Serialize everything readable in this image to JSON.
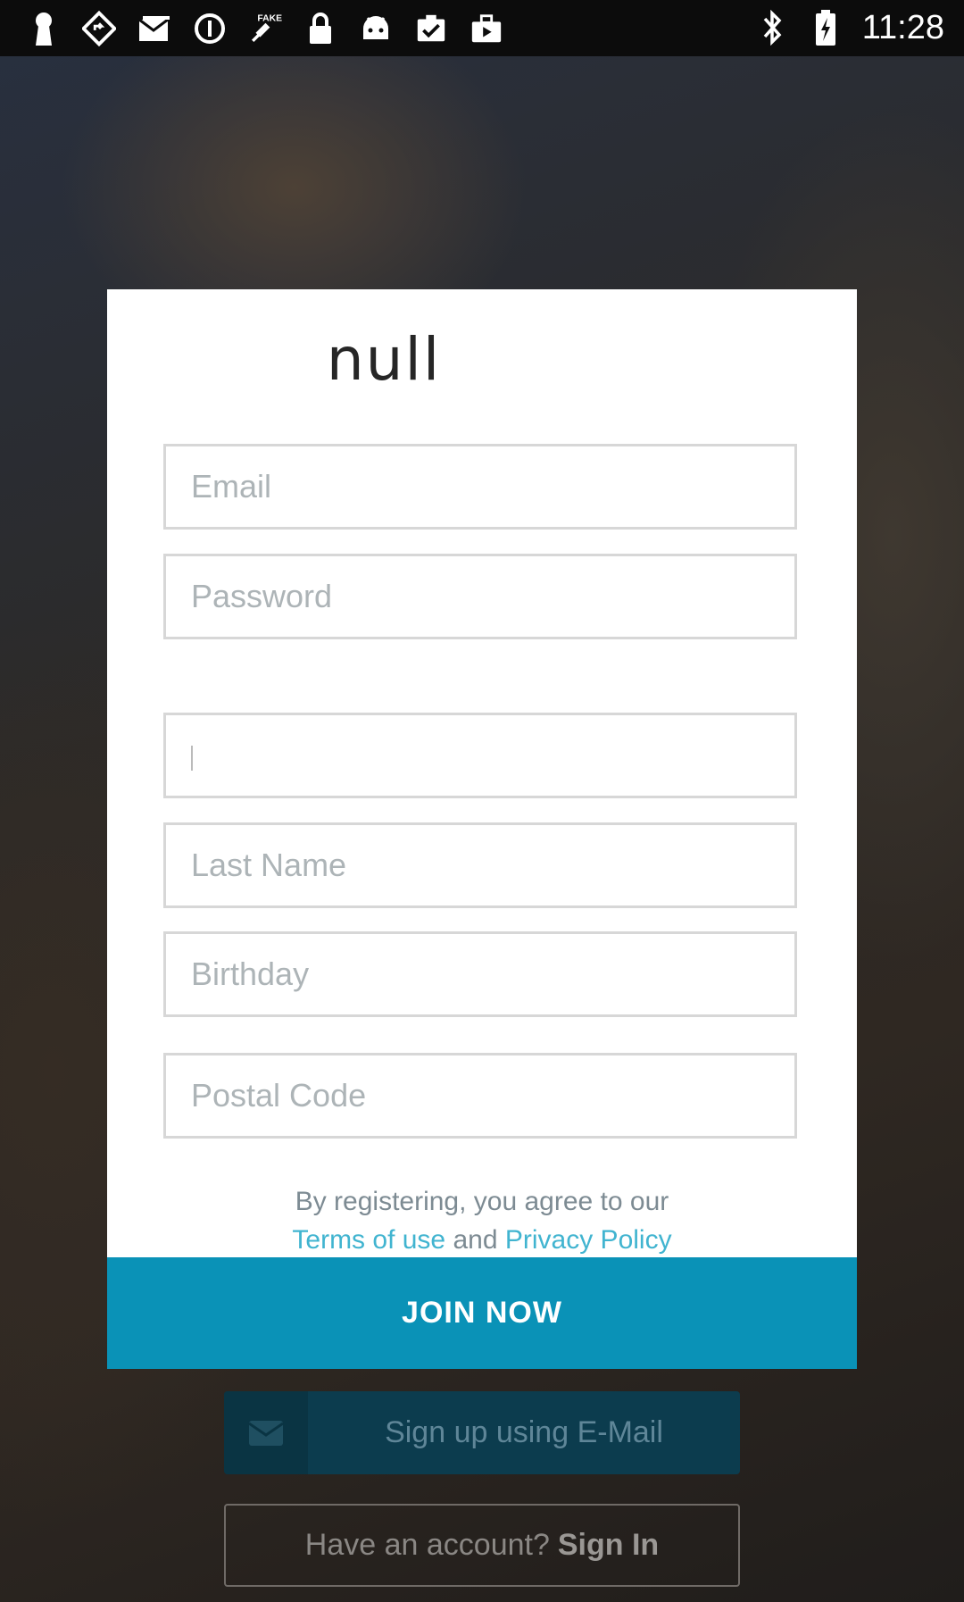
{
  "status_bar": {
    "time": "11:28",
    "icons": [
      "keyhole-icon",
      "diamond-nav-icon",
      "mail-icon",
      "circle-info-icon",
      "fake-gps-icon",
      "lock-icon",
      "android-icon",
      "clipboard-check-icon",
      "briefcase-icon",
      "bluetooth-icon",
      "battery-icon"
    ]
  },
  "dialog": {
    "brand": "null",
    "fields": {
      "email_placeholder": "Email",
      "password_placeholder": "Password",
      "first_name_value": "",
      "last_name_placeholder": "Last Name",
      "birthday_placeholder": "Birthday",
      "postal_code_placeholder": "Postal Code"
    },
    "terms": {
      "prefix": "By registering, you agree to our",
      "terms_link": "Terms of use",
      "and": "and",
      "privacy_link": "Privacy Policy"
    },
    "join_label": "JOIN NOW"
  },
  "bottom": {
    "email_signup_label": "Sign up using E-Mail",
    "have_account_label": "Have an account?",
    "sign_in_label": "Sign In"
  },
  "colors": {
    "accent": "#0a92b7",
    "link": "#41b4d0",
    "email_button": "#0c3c4e"
  }
}
